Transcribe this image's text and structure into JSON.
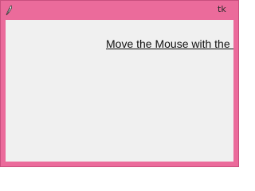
{
  "window": {
    "title": "tk",
    "icon": "feather-icon",
    "frame_color": "#eb6b9b",
    "client_color": "#f0f0f0"
  },
  "content": {
    "label_text": "Move the Mouse with the L"
  }
}
